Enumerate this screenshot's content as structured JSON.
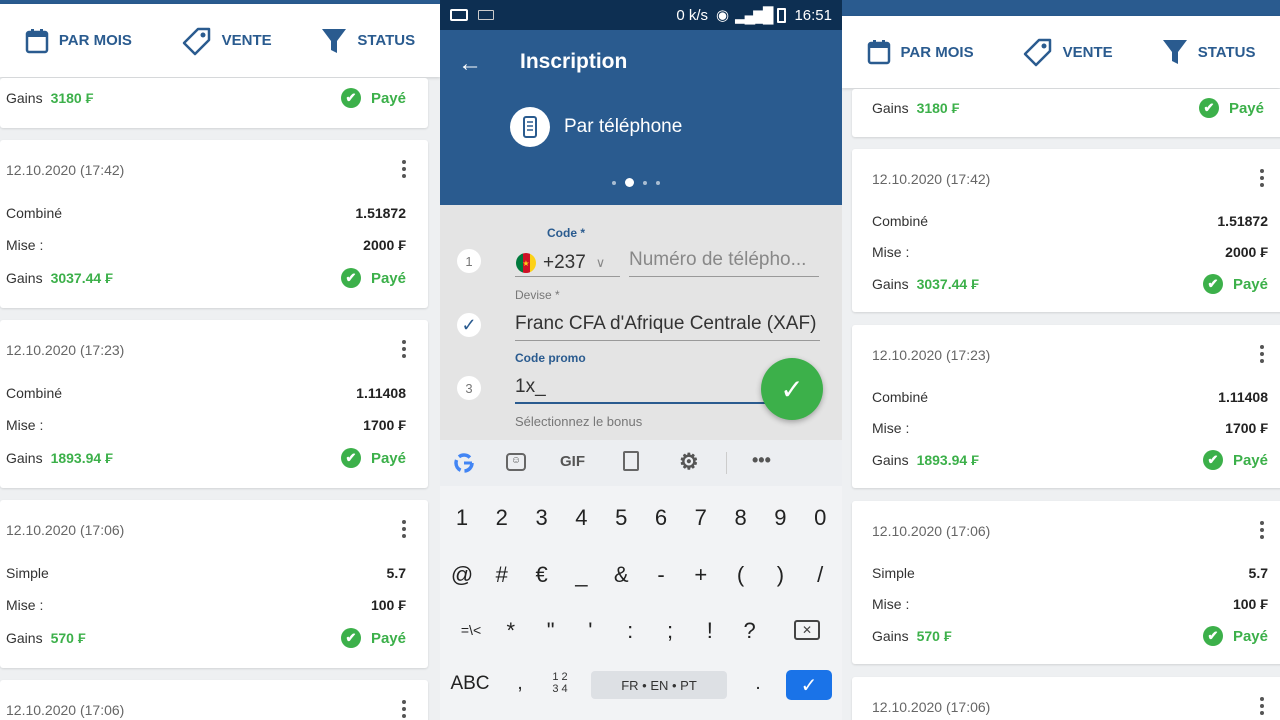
{
  "filters": {
    "month": "PAR MOIS",
    "sale": "VENTE",
    "status": "STATUS"
  },
  "labels": {
    "gains": "Gains",
    "mise": "Mise :",
    "paid": "Payé"
  },
  "cards": [
    {
      "gains": "3180 ₣"
    },
    {
      "date": "12.10.2020 (17:42)",
      "type": "Combiné",
      "odds": "1.51872",
      "stake": "2000 ₣",
      "gains": "3037.44 ₣"
    },
    {
      "date": "12.10.2020 (17:23)",
      "type": "Combiné",
      "odds": "1.11408",
      "stake": "1700 ₣",
      "gains": "1893.94 ₣"
    },
    {
      "date": "12.10.2020 (17:06)",
      "type": "Simple",
      "odds": "5.7",
      "stake": "100 ₣",
      "gains": "570 ₣"
    },
    {
      "date": "12.10.2020 (17:06)"
    }
  ],
  "phone": {
    "status_speed": "0 k/s",
    "status_time": "16:51",
    "title": "Inscription",
    "method": "Par téléphone",
    "step_page": 2,
    "step_count": 4,
    "code_label": "Code *",
    "dial_code": "+237",
    "phone_placeholder": "Numéro de télépho...",
    "currency_label": "Devise *",
    "currency_value": "Franc CFA d'Afrique Centrale (XAF)",
    "promo_label": "Code promo",
    "promo_value": "1x_",
    "bonus_hint": "Sélectionnez le bonus",
    "steps": [
      "1",
      "3"
    ]
  },
  "keyboard": {
    "gif": "GIF",
    "row1": [
      "1",
      "2",
      "3",
      "4",
      "5",
      "6",
      "7",
      "8",
      "9",
      "0"
    ],
    "row2": [
      "@",
      "#",
      "€",
      "_",
      "&",
      "-",
      "+",
      "(",
      ")",
      "/"
    ],
    "row3": [
      "=\\<",
      "*",
      "\"",
      "'",
      ":",
      ";",
      "!",
      "?"
    ],
    "abc": "ABC",
    "comma": ",",
    "numpad_top": "1 2",
    "numpad_bottom": "3 4",
    "space": "FR • EN • PT",
    "period": "."
  },
  "colors": {
    "brand": "#2a5b8f",
    "success": "#3cb04a"
  }
}
